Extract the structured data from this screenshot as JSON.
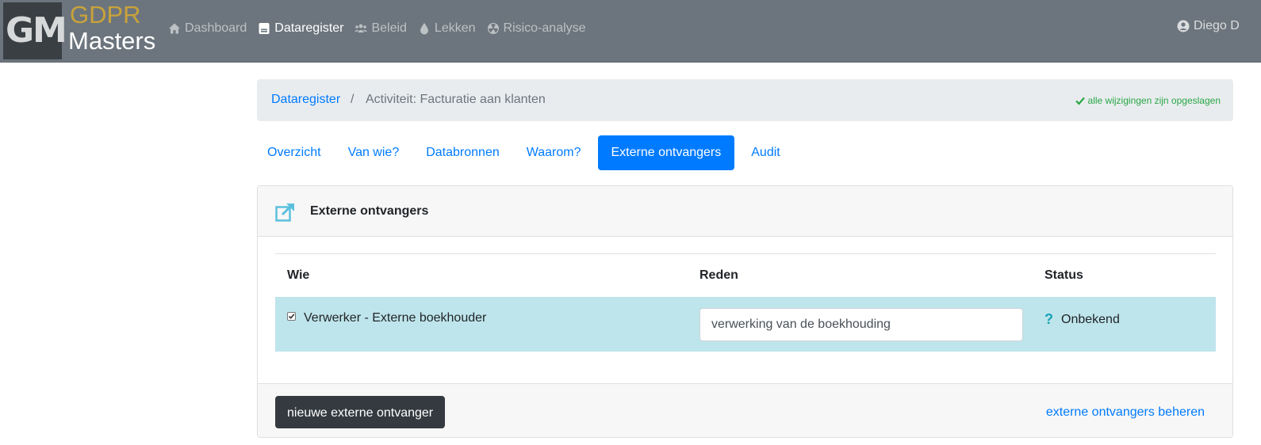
{
  "brand": {
    "mark_g": "G",
    "mark_m": "M",
    "name_top": "GDPR",
    "name_bottom": "Masters"
  },
  "nav": {
    "items": [
      {
        "label": "Dashboard",
        "icon": "home-icon"
      },
      {
        "label": "Dataregister",
        "icon": "register-icon",
        "active": true
      },
      {
        "label": "Beleid",
        "icon": "users-icon"
      },
      {
        "label": "Lekken",
        "icon": "droplet-icon"
      },
      {
        "label": "Risico-analyse",
        "icon": "radiation-icon"
      }
    ],
    "user": "Diego D",
    "user_icon": "user-circle-icon"
  },
  "breadcrumb": {
    "root": "Dataregister",
    "separator": "/",
    "current": "Activiteit: Facturatie aan klanten",
    "saved_status": "alle wijzigingen zijn opgeslagen"
  },
  "tabs": [
    {
      "label": "Overzicht"
    },
    {
      "label": "Van wie?"
    },
    {
      "label": "Databronnen"
    },
    {
      "label": "Waarom?"
    },
    {
      "label": "Externe ontvangers",
      "active": true
    },
    {
      "label": "Audit"
    }
  ],
  "card": {
    "title": "Externe ontvangers",
    "icon": "external-link-icon",
    "columns": {
      "who": "Wie",
      "reason": "Reden",
      "status": "Status"
    },
    "rows": [
      {
        "checked": true,
        "who": "Verwerker - Externe boekhouder",
        "reason": "verwerking van de boekhouding",
        "status_icon": "?",
        "status": "Onbekend"
      }
    ],
    "footer": {
      "new_button": "nieuwe externe ontvanger",
      "manage_link": "externe ontvangers beheren"
    }
  },
  "colors": {
    "navbar": "#6c757d",
    "primary": "#007bff",
    "row_highlight": "#bee5eb",
    "success": "#28a745",
    "brand_gold": "#c9a23a"
  }
}
